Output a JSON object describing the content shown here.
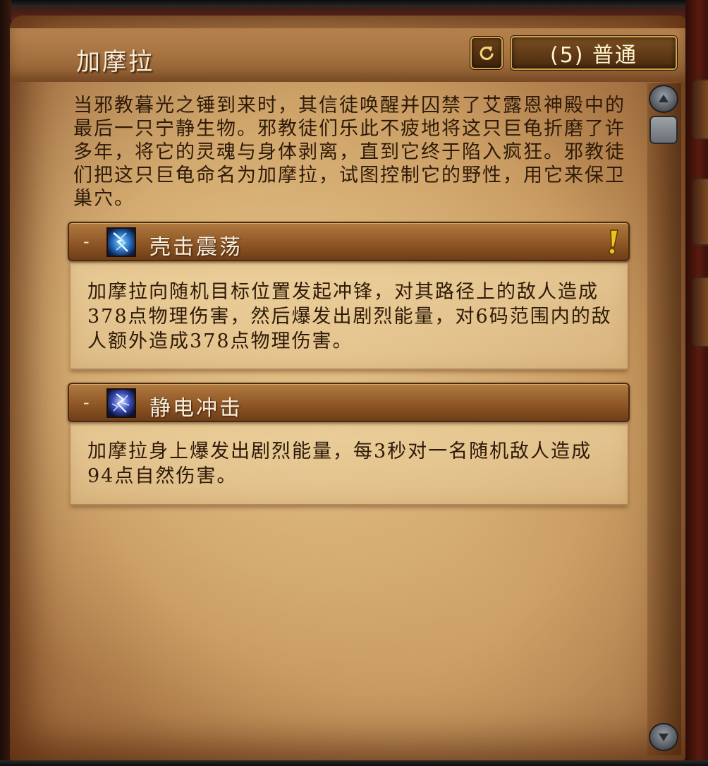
{
  "encounter": {
    "title": "加摩拉",
    "difficulty_label": "(5) 普通",
    "description": "当邪教暮光之锤到来时，其信徒唤醒并囚禁了艾露恩神殿中的最后一只宁静生物。邪教徒们乐此不疲地将这只巨龟折磨了许多年，将它的灵魂与身体剥离，直到它终于陷入疯狂。邪教徒们把这只巨龟命名为加摩拉，试图控制它的野性，用它来保卫巢穴。"
  },
  "abilities": [
    {
      "toggle": "-",
      "name": "壳击震荡",
      "icon": "shell-shock-spell-icon",
      "alert_icon": "exclamation-icon",
      "alert_color": "#f2c21a",
      "text": "加摩拉向随机目标位置发起冲锋，对其路径上的敌人造成378点物理伤害，然后爆发出剧烈能量，对6码范围内的敌人额外造成378点物理伤害。"
    },
    {
      "toggle": "-",
      "name": "静电冲击",
      "icon": "static-shock-spell-icon",
      "text": "加摩拉身上爆发出剧烈能量，每3秒对一名随机敌人造成94点自然伤害。"
    }
  ],
  "controls": {
    "reset_icon": "reset-arrow-icon",
    "scroll_up_icon": "scroll-up-icon",
    "scroll_down_icon": "scroll-down-icon"
  }
}
